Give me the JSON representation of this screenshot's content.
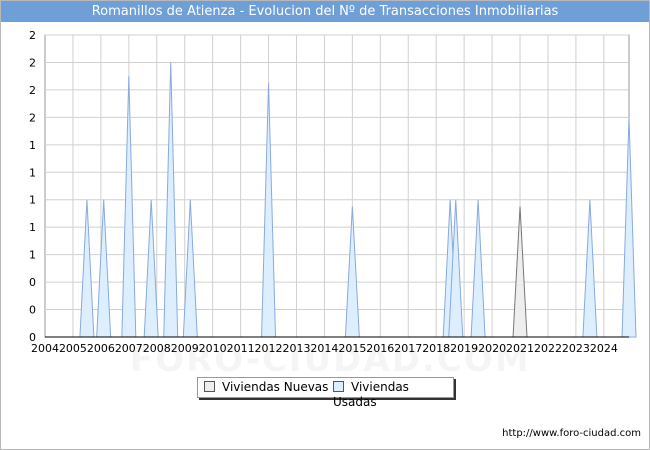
{
  "title": "Romanillos de Atienza - Evolucion del Nº de Transacciones Inmobiliarias",
  "credit": "http://www.foro-ciudad.com",
  "watermark": "FORO-CIUDAD.COM",
  "colors": {
    "title_bg": "#6e9fd6",
    "nuevas_fill": "#eeeeee",
    "nuevas_stroke": "#777777",
    "usadas_fill": "#ddeeff",
    "usadas_stroke": "#88aadd",
    "grid": "#d0d0d0"
  },
  "legend": [
    {
      "label": "Viviendas Nuevas",
      "color": "#eeeeee"
    },
    {
      "label": "Viviendas Usadas",
      "color": "#ddeeff"
    }
  ],
  "chart_data": {
    "type": "area",
    "title": "Romanillos de Atienza - Evolucion del Nº de Transacciones Inmobiliarias",
    "xlabel": "",
    "ylabel": "",
    "x_tick_labels": [
      "2004",
      "2005",
      "2006",
      "2007",
      "2008",
      "2009",
      "2010",
      "2011",
      "2012",
      "2013",
      "2014",
      "2015",
      "2016",
      "2017",
      "2018",
      "2019",
      "2020",
      "2021",
      "2022",
      "2023",
      "2024"
    ],
    "y_tick_labels": [
      "0",
      "0",
      "0",
      "1",
      "1",
      "1",
      "1",
      "1",
      "2",
      "2",
      "2",
      "2"
    ],
    "ylim": [
      0,
      2.2
    ],
    "grid": true,
    "legend_position": "bottom",
    "series": [
      {
        "name": "Viviendas Usadas",
        "points": [
          [
            2005.5,
            1
          ],
          [
            2006.1,
            1
          ],
          [
            2007.0,
            1.9
          ],
          [
            2007.8,
            1
          ],
          [
            2008.5,
            2.0
          ],
          [
            2009.2,
            1
          ],
          [
            2012.0,
            1.85
          ],
          [
            2015.0,
            0.95
          ],
          [
            2018.5,
            1
          ],
          [
            2018.7,
            1
          ],
          [
            2019.5,
            1
          ],
          [
            2023.5,
            1
          ],
          [
            2024.9,
            1.6
          ]
        ]
      },
      {
        "name": "Viviendas Nuevas",
        "points": [
          [
            2021.0,
            0.95
          ]
        ]
      }
    ]
  }
}
